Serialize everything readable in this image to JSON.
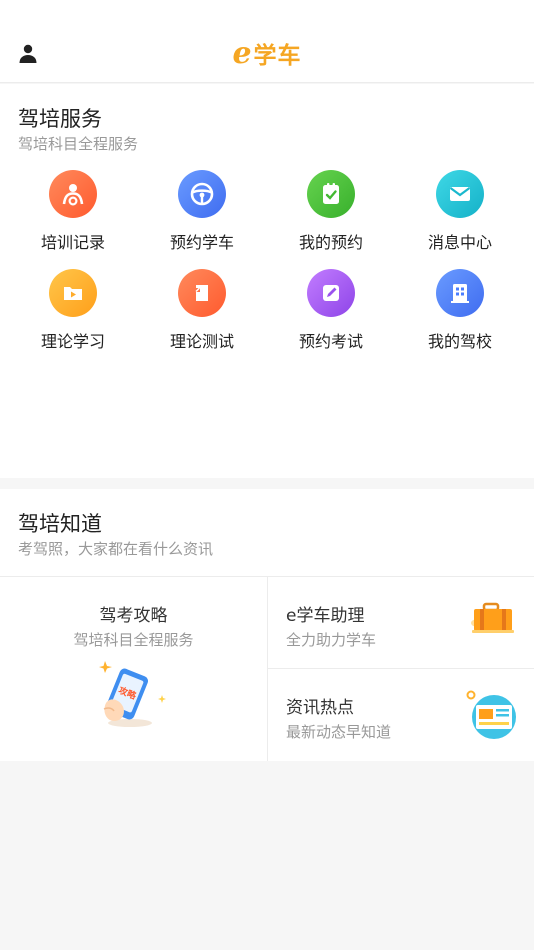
{
  "header": {
    "logo_e": "e",
    "logo_text": "学车",
    "user_icon": "user-icon"
  },
  "services": {
    "title": "驾培服务",
    "subtitle": "驾培科目全程服务",
    "items": [
      {
        "label": "培训记录",
        "icon": "driver-icon",
        "color": "#ff6a3d"
      },
      {
        "label": "预约学车",
        "icon": "steering-wheel-icon",
        "color": "#4a7dff"
      },
      {
        "label": "我的预约",
        "icon": "clipboard-check-icon",
        "color": "#48c23c"
      },
      {
        "label": "消息中心",
        "icon": "mail-icon",
        "color": "#1cc1d6"
      },
      {
        "label": "理论学习",
        "icon": "folder-play-icon",
        "color": "#ffb22e"
      },
      {
        "label": "理论测试",
        "icon": "test-doc-icon",
        "color": "#ff6a3d"
      },
      {
        "label": "预约考试",
        "icon": "edit-icon",
        "color": "#a35cf0"
      },
      {
        "label": "我的驾校",
        "icon": "building-icon",
        "color": "#4a7dff"
      }
    ]
  },
  "knowledge": {
    "title": "驾培知道",
    "subtitle": "考驾照，大家都在看什么资讯",
    "left_card": {
      "title": "驾考攻略",
      "subtitle": "驾培科目全程服务",
      "icon": "phone-guide-icon",
      "art_text": "攻略"
    },
    "right_cards": [
      {
        "title": "e学车助理",
        "subtitle": "全力助力学车",
        "icon": "briefcase-icon"
      },
      {
        "title": "资讯热点",
        "subtitle": "最新动态早知道",
        "icon": "news-icon"
      }
    ]
  }
}
